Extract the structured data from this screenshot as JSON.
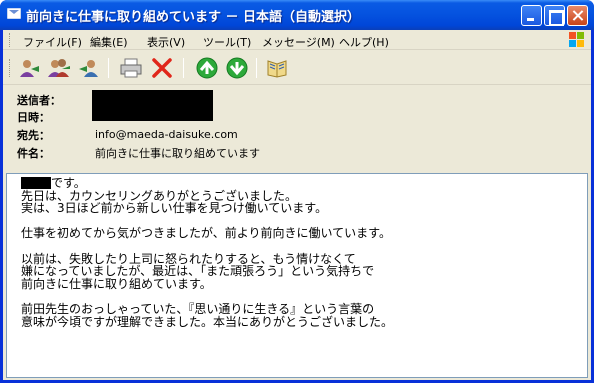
{
  "window": {
    "title": "前向きに仕事に取り組めています － 日本語（自動選択）"
  },
  "menu": {
    "items": [
      "ファイル(F)",
      "編集(E)",
      "表示(V)",
      "ツール(T)",
      "メッセージ(M)",
      "ヘルプ(H)"
    ]
  },
  "toolbar": {
    "icons": [
      "reply-icon",
      "reply-all-icon",
      "forward-icon",
      "print-icon",
      "delete-icon",
      "previous-icon",
      "next-icon",
      "addresses-icon"
    ]
  },
  "header": {
    "from_label": "送信者：",
    "date_label": "日時：",
    "to_label": "宛先：",
    "to_value": "info@maeda-daisuke.com",
    "subject_label": "件名：",
    "subject_value": "前向きに仕事に取り組めています"
  },
  "body": {
    "line1_suffix": "です。",
    "line2": "先日は、カウンセリングありがとうございました。",
    "line3": "実は、3日ほど前から新しい仕事を見つけ働いています。",
    "line4": "仕事を初めてから気がつきましたが、前より前向きに働いています。",
    "line5": "以前は、失敗したり上司に怒られたりすると、もう情けなくて",
    "line6": "嫌になっていましたが、最近は、「また頑張ろう」という気持ちで",
    "line7": "前向きに仕事に取り組めています。",
    "line8": "前田先生のおっしゃっていた、『思い通りに生きる』という言葉の",
    "line9": "意味が今頃ですが理解できました。本当にありがとうございました。"
  },
  "colors": {
    "titlebar": "#0553e0",
    "client_bg": "#ece9d8",
    "close_button": "#c94419"
  }
}
